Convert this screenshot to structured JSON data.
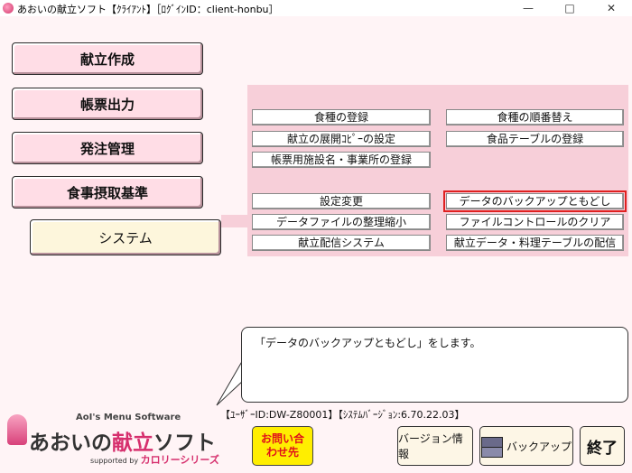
{
  "window": {
    "title": "あおいの献立ソフト【ｸﾗｲｱﾝﾄ】［ﾛｸﾞｲﾝID：client-honbu］",
    "minimize": "—",
    "maximize": "□",
    "close": "✕"
  },
  "menu": {
    "items": [
      "献立作成",
      "帳票出力",
      "発注管理",
      "食事摂取基準",
      "システム"
    ]
  },
  "system_panel": {
    "left": [
      "食種の登録",
      "献立の展開ｺﾋﾟｰの設定",
      "帳票用施設名・事業所の登録",
      "設定変更",
      "データファイルの整理縮小",
      "献立配信システム"
    ],
    "right": [
      "食種の順番替え",
      "食品テーブルの登録",
      "データのバックアップともどし",
      "ファイルコントロールのクリア",
      "献立データ・料理テーブルの配信"
    ]
  },
  "message": "「データのバックアップともどし」をします。",
  "status": {
    "user_id": "【ﾕｰｻﾞｰID:DW-Z80001】",
    "version": "【ｼｽﾃﾑﾊﾞｰｼﾞｮﾝ:6.70.22.03】"
  },
  "logo": {
    "tagline": "AoI's Menu Software",
    "name_pre": "あおいの",
    "name_accent": "献立",
    "name_post": "ソフト",
    "supported": "supported by",
    "series": "カロリーシリーズ"
  },
  "bottom": {
    "contact_line1": "お問い合",
    "contact_line2": "わせ先",
    "version_info": "バージョン情報",
    "backup": "バックアップ",
    "exit": "終了"
  },
  "colors": {
    "accent": "#d62f6d",
    "panel": "#f7cfd9",
    "selection": "#e02020"
  }
}
